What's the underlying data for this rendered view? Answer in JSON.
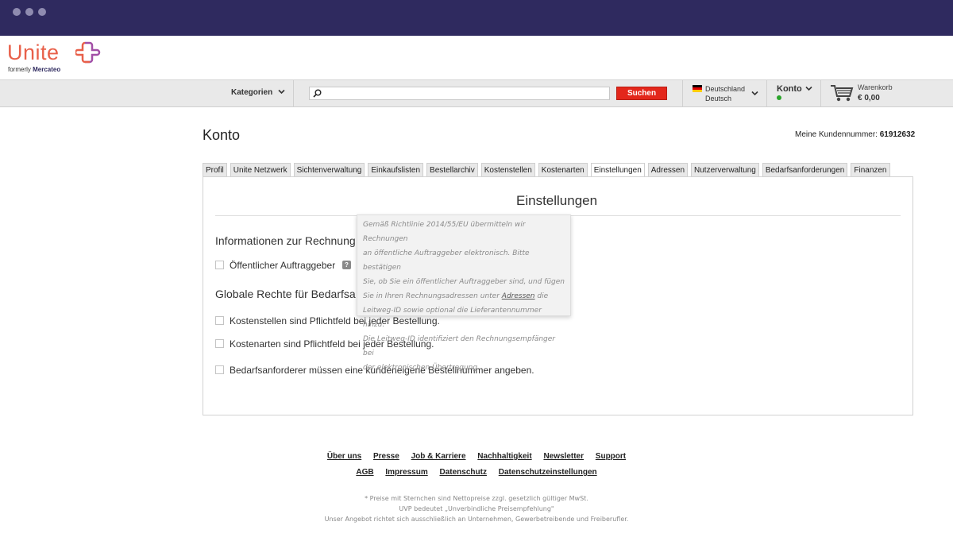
{
  "window": {
    "controls": [
      "close",
      "minimize",
      "maximize"
    ]
  },
  "logo": {
    "brand": "Unite",
    "formerly_prefix": "formerly",
    "formerly_name": "Mercateo"
  },
  "header": {
    "categories_label": "Kategorien",
    "search": {
      "placeholder": "",
      "button_label": "Suchen"
    },
    "country": "Deutschland",
    "language": "Deutsch",
    "account_label": "Konto",
    "cart_label": "Warenkorb",
    "cart_total": "€ 0,00"
  },
  "page": {
    "title": "Konto",
    "customer_number_label": "Meine Kundennummer:",
    "customer_number": "61912632"
  },
  "tabs": [
    {
      "label": "Profil"
    },
    {
      "label": "Unite Netzwerk"
    },
    {
      "label": "Sichtenverwaltung"
    },
    {
      "label": "Einkaufslisten"
    },
    {
      "label": "Bestellarchiv"
    },
    {
      "label": "Kostenstellen"
    },
    {
      "label": "Kostenarten"
    },
    {
      "label": "Einstellungen",
      "active": true
    },
    {
      "label": "Adressen"
    },
    {
      "label": "Nutzerverwaltung"
    },
    {
      "label": "Bedarfsanforderungen"
    },
    {
      "label": "Finanzen"
    }
  ],
  "settings": {
    "title": "Einstellungen",
    "invoice_section": {
      "heading": "Informationen zur Rechnung",
      "public_client_label": "Öffentlicher Auftraggeber",
      "help_glyph": "?"
    },
    "global_section": {
      "heading": "Globale Rechte für Bedarfsa",
      "options": [
        {
          "label": "Kostenstellen sind Pflichtfeld bei jeder Bestellung.",
          "checked": false
        },
        {
          "label": "Kostenarten sind Pflichtfeld bei jeder Bestellung.",
          "checked": false
        },
        {
          "label": "Bedarfsanforderer müssen eine kundeneigene Bestellnummer angeben.",
          "checked": false
        }
      ]
    }
  },
  "tooltip": {
    "line1": "Gemäß Richtlinie 2014/55/EU übermitteln wir Rechnungen",
    "line2": "an öffentliche Auftraggeber elektronisch. Bitte bestätigen",
    "line3": "Sie, ob Sie ein öffentlicher Auftraggeber sind, und fügen",
    "line4_before": "Sie in Ihren Rechnungsadressen unter ",
    "line4_link": "Adressen",
    "line4_after": " die",
    "line5": "Leitweg-ID sowie optional die Lieferantennummer hinzu.",
    "line6": "Die Leitweg-ID identifiziert den Rechnungsempfänger bei",
    "line7": "der elektronischen Übertragung."
  },
  "footer": {
    "links_row1": [
      "Über uns",
      "Presse",
      "Job & Karriere",
      "Nachhaltigkeit",
      "Newsletter",
      "Support"
    ],
    "links_row2": [
      "AGB",
      "Impressum",
      "Datenschutz",
      "Datenschutzeinstellungen"
    ],
    "notes": [
      "* Preise mit Sternchen sind Nettopreise zzgl. gesetzlich gültiger MwSt.",
      "UVP bedeutet „Unverbindliche Preisempfehlung\"",
      "Unser Angebot richtet sich ausschließlich an Unternehmen, Gewerbetreibende und Freiberufler."
    ]
  },
  "colors": {
    "titlebar": "#2f2a5f",
    "brand": "#e8604a",
    "search_button": "#e3271b",
    "online": "#2aa52a"
  }
}
